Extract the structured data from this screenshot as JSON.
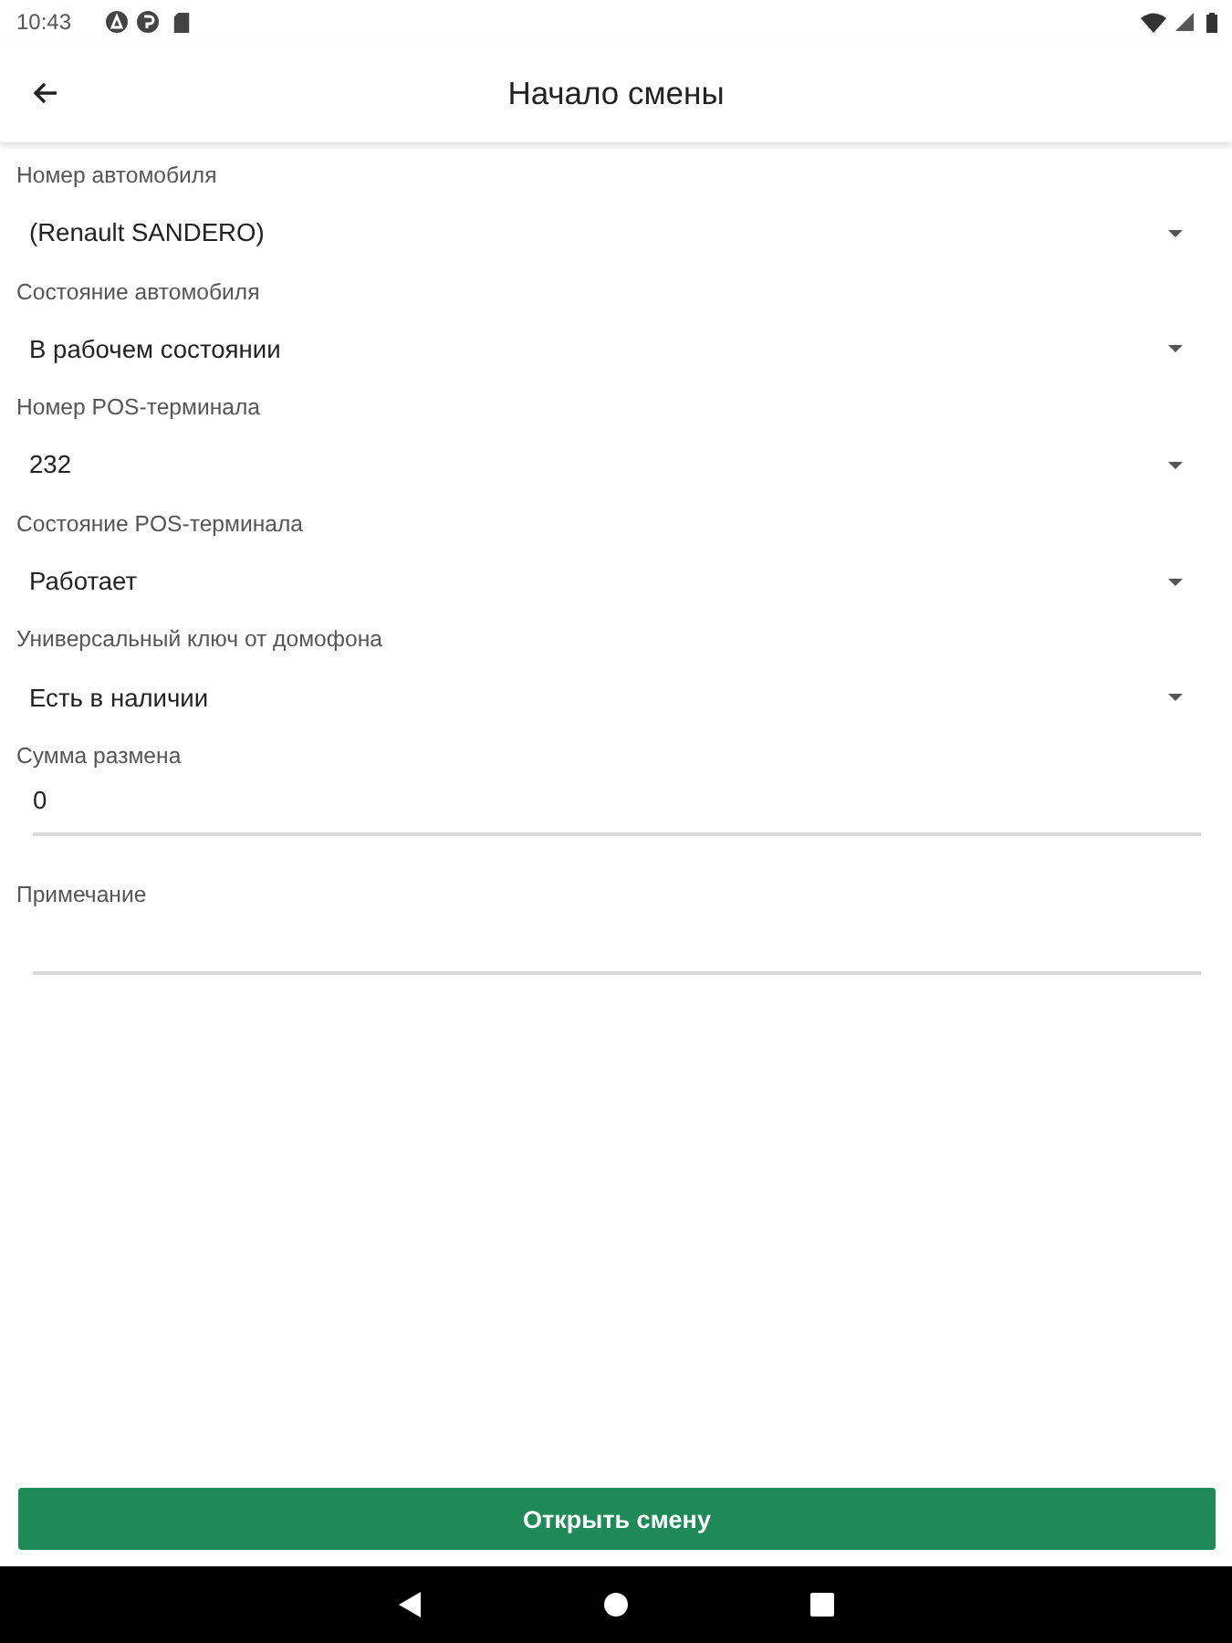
{
  "status_bar": {
    "time": "10:43"
  },
  "app_bar": {
    "title": "Начало смены"
  },
  "fields": [
    {
      "kind": "dropdown",
      "label": "Номер автомобиля",
      "value": "(Renault SANDERO)"
    },
    {
      "kind": "dropdown",
      "label": "Состояние автомобиля",
      "value": "В рабочем состоянии"
    },
    {
      "kind": "dropdown",
      "label": "Номер POS-терминала",
      "value": "232"
    },
    {
      "kind": "dropdown",
      "label": "Состояние POS-терминала",
      "value": "Работает"
    },
    {
      "kind": "dropdown",
      "label": "Универсальный ключ от домофона",
      "value": "Есть в наличии"
    },
    {
      "kind": "text",
      "label": "Сумма размена",
      "value": "0"
    },
    {
      "kind": "text",
      "label": "Примечание"
    }
  ],
  "primary_button": {
    "label": "Открыть смену"
  }
}
